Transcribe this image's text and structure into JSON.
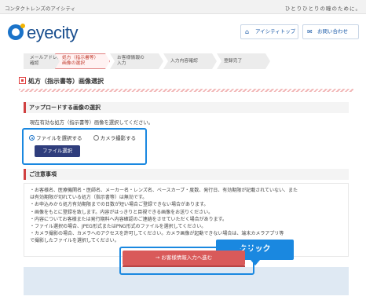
{
  "topbar": {
    "left_text": "コンタクトレンズのアイシティ",
    "right_text": "ひとりひとりの瞳のために。"
  },
  "logo": {
    "text": "eyecity"
  },
  "header": {
    "top_button": "アイシティトップ",
    "top_icon": "home-icon",
    "contact_button": "お問い合わせ",
    "contact_icon": "mail-icon"
  },
  "steps": [
    {
      "label": "メールアドレスの確認",
      "line1": "メールアドレスの",
      "line2": "確認",
      "active": false
    },
    {
      "label": "処方(指示書等)画像の選択",
      "line1": "処方（指示書等）",
      "line2": "画像の選択",
      "active": true
    },
    {
      "label": "お客様情報の入力",
      "line1": "お客様情報の",
      "line2": "入力",
      "active": false
    },
    {
      "label": "入力内容確認",
      "line1": "入力内容確認",
      "line2": "",
      "active": false
    },
    {
      "label": "登録完了",
      "line1": "登録完了",
      "line2": "",
      "active": false
    }
  ],
  "page_title": "処方（指示書等）画像選択",
  "upload": {
    "heading": "アップロードする画像の選択",
    "description": "現在有効な処方（指示書等）画像を選択してください。",
    "radio_file": "ファイルを選択する",
    "radio_camera": "カメラ撮影する",
    "selected": "radio_file",
    "file_button": "ファイル選択"
  },
  "notice": {
    "heading": "ご注意事項",
    "lines": [
      "・お客様名、医療機関名・医師名、メーカー名・レンズ名、ベースカーブ・度数、発行日、有効期限が記載されていない、また",
      "は有効期限が切れている処方（指示書等）は無効です。",
      "・お申込みから処方有効期限までの日数が短い場合ご登録できない場合があります。",
      "・画像をもとに登録を致します。内容がはっきりと目視できる画像をお送りください。",
      "・内容についてお客様または発行期料へ内容確認のご連絡をさせていただく場合があります。",
      "・ファイル選択の場合、JPEG形式またはPNG形式のファイルを選択してください。",
      "・カメラ撮影の場合、カメラへのアクセスを許可してください。カメラ画像が起動できない場合は、端末カメラアプリ等",
      "で撮影したファイルを選択してください。"
    ]
  },
  "callout": "クリック",
  "cta": {
    "label": "→ お客様情報入力へ進む"
  },
  "colors": {
    "brand_blue": "#1a73c9",
    "accent_red": "#d95a5a",
    "highlight_blue": "#1a88e0",
    "file_button": "#2f3d7c"
  }
}
